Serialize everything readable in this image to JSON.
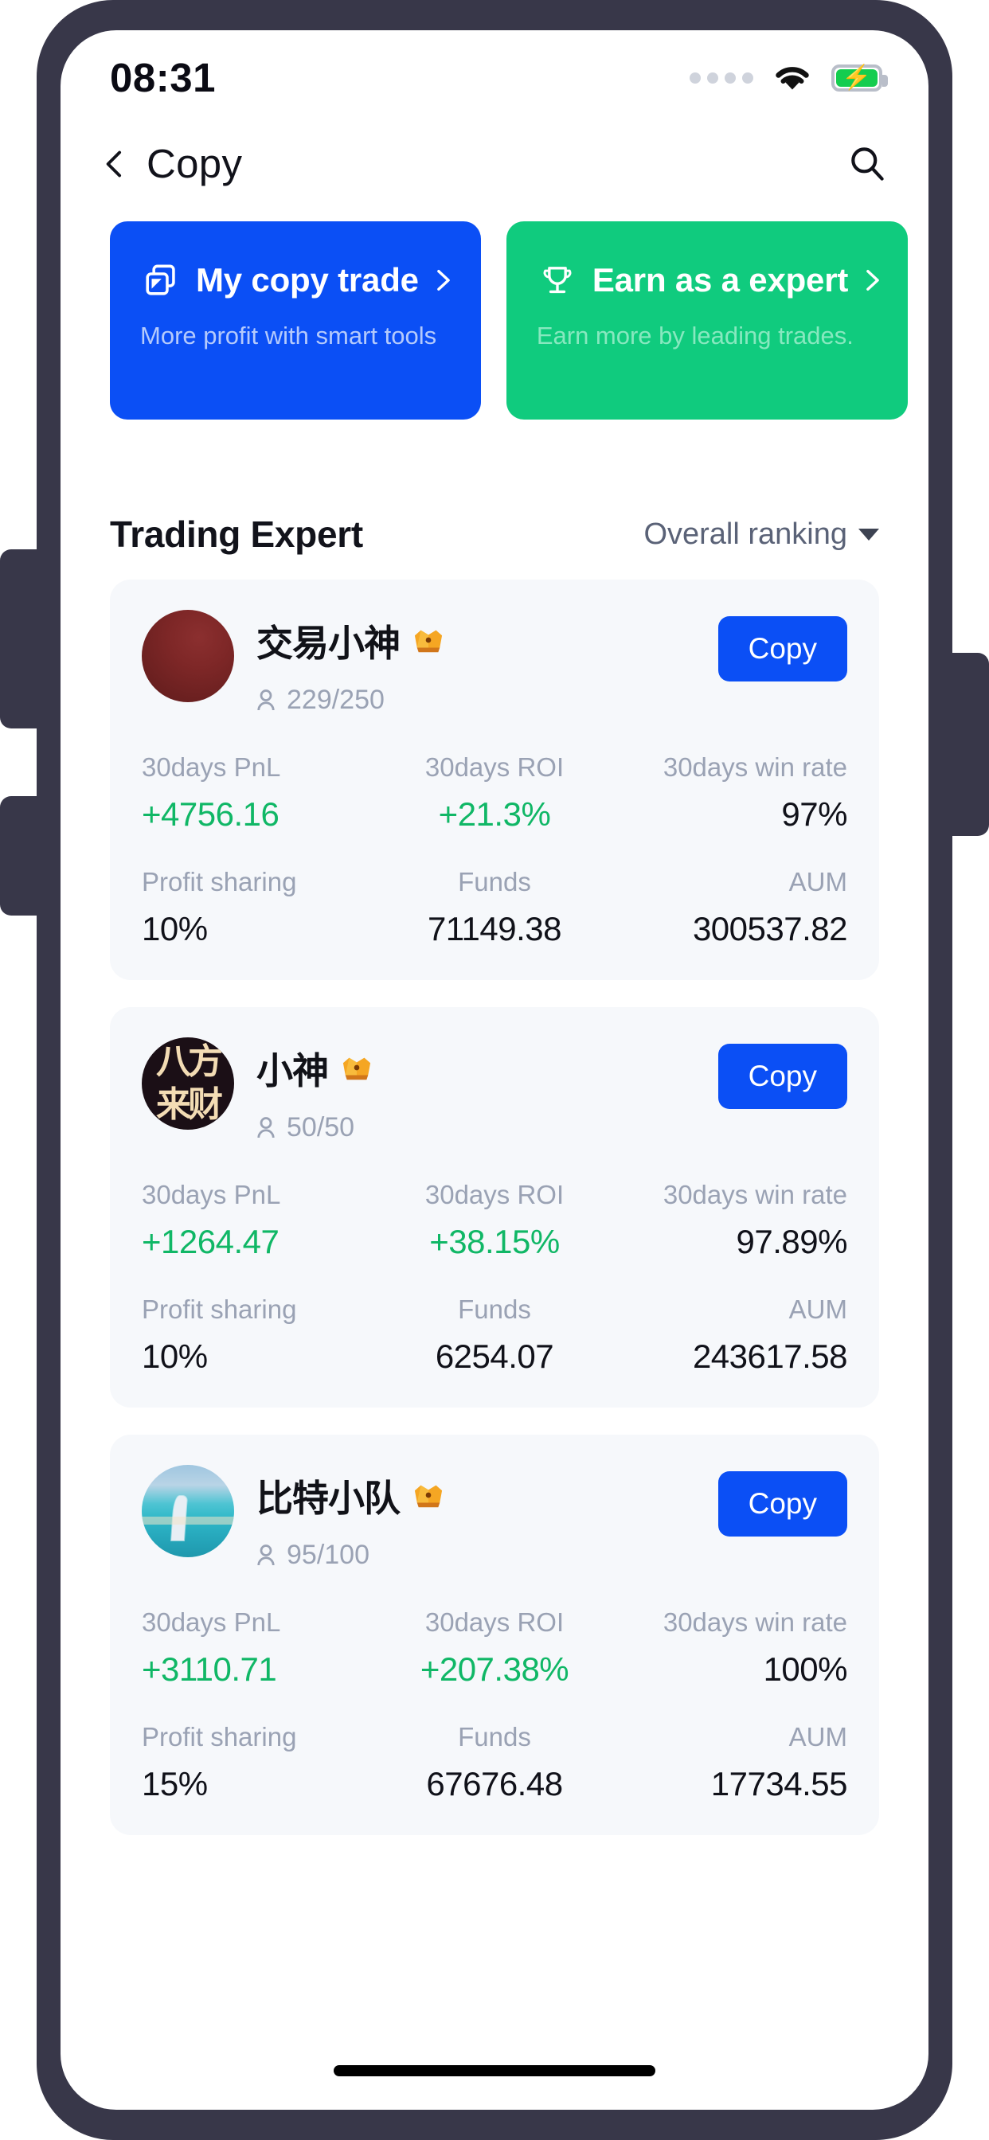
{
  "status_bar": {
    "time": "08:31",
    "signal_icon": "signal-dots-icon",
    "wifi_icon": "wifi-icon",
    "battery_icon": "battery-charging-icon"
  },
  "nav": {
    "back_icon": "chevron-left-icon",
    "title": "Copy",
    "search_icon": "search-icon"
  },
  "promos": [
    {
      "icon": "copy-documents-icon",
      "title": "My copy trade",
      "chevron_icon": "chevron-right-icon",
      "subtitle": "More profit with smart tools",
      "color": "#0b4ff5"
    },
    {
      "icon": "trophy-icon",
      "title": "Earn as a expert",
      "chevron_icon": "chevron-right-icon",
      "subtitle": "Earn more by leading trades.",
      "color": "#10cb7e"
    }
  ],
  "section": {
    "title": "Trading Expert",
    "ranking_label": "Overall ranking",
    "ranking_caret_icon": "chevron-down-icon"
  },
  "labels": {
    "pnl": "30days PnL",
    "roi": "30days ROI",
    "win_rate": "30days win rate",
    "profit_sharing": "Profit sharing",
    "funds": "Funds",
    "aum": "AUM",
    "copy_button": "Copy",
    "followers_icon": "person-icon",
    "badge_icon": "crown-badge-icon"
  },
  "traders": [
    {
      "name": "交易小神",
      "avatar_style": "av-red",
      "followers": "229/250",
      "pnl": "+4756.16",
      "roi": "+21.3%",
      "win_rate": "97%",
      "profit_sharing": "10%",
      "funds": "71149.38",
      "aum": "300537.82"
    },
    {
      "name": "小神",
      "avatar_style": "av-dark",
      "followers": "50/50",
      "pnl": "+1264.47",
      "roi": "+38.15%",
      "win_rate": "97.89%",
      "profit_sharing": "10%",
      "funds": "6254.07",
      "aum": "243617.58"
    },
    {
      "name": "比特小队",
      "avatar_style": "av-dubai",
      "followers": "95/100",
      "pnl": "+3110.71",
      "roi": "+207.38%",
      "win_rate": "100%",
      "profit_sharing": "15%",
      "funds": "67676.48",
      "aum": "17734.55"
    }
  ],
  "colors": {
    "accent_blue": "#0b4ff5",
    "accent_green": "#10cb7e",
    "positive": "#10b766",
    "card_bg": "#f6f8fb",
    "muted_text": "#9aa2b4",
    "frame": "#383749"
  }
}
